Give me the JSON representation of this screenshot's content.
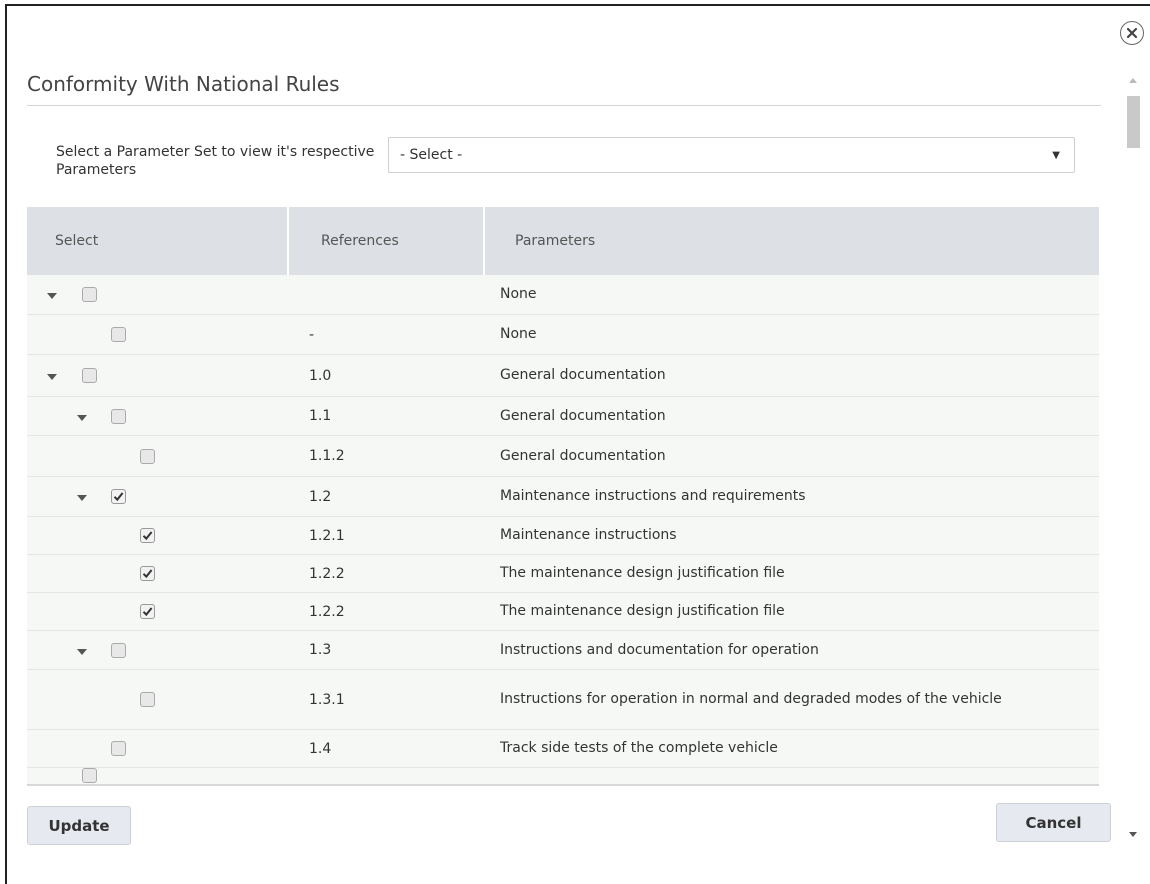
{
  "dialog": {
    "title": "Conformity With National Rules",
    "close_icon": "close-icon"
  },
  "param_set": {
    "label": "Select a Parameter Set to view it's respective Parameters",
    "selected": "- Select -"
  },
  "table": {
    "headers": [
      "Select",
      "References",
      "Parameters"
    ],
    "rows": [
      {
        "level": 0,
        "expandable": true,
        "checked": false,
        "ref": "",
        "param": "None"
      },
      {
        "level": 1,
        "expandable": false,
        "checked": false,
        "ref": "-",
        "param": "None"
      },
      {
        "level": 0,
        "expandable": true,
        "checked": false,
        "ref": "1.0",
        "param": "General documentation"
      },
      {
        "level": 1,
        "expandable": true,
        "checked": false,
        "ref": "1.1",
        "param": "General documentation"
      },
      {
        "level": 2,
        "expandable": false,
        "checked": false,
        "ref": "1.1.2",
        "param": "General documentation"
      },
      {
        "level": 1,
        "expandable": true,
        "checked": true,
        "ref": "1.2",
        "param": "Maintenance instructions and requirements"
      },
      {
        "level": 2,
        "expandable": false,
        "checked": true,
        "ref": "1.2.1",
        "param": "Maintenance instructions"
      },
      {
        "level": 2,
        "expandable": false,
        "checked": true,
        "ref": "1.2.2",
        "param": "The maintenance design justification file"
      },
      {
        "level": 2,
        "expandable": false,
        "checked": true,
        "ref": "1.2.2",
        "param": "The maintenance design justification file"
      },
      {
        "level": 1,
        "expandable": true,
        "checked": false,
        "ref": "1.3",
        "param": "Instructions and documentation for operation"
      },
      {
        "level": 2,
        "expandable": false,
        "checked": false,
        "ref": "1.3.1",
        "param": "Instructions for operation in normal and degraded modes of the vehicle"
      },
      {
        "level": 1,
        "expandable": false,
        "checked": false,
        "ref": "1.4",
        "param": "Track side tests of the complete vehicle"
      },
      {
        "level": 0,
        "expandable": false,
        "checked": false,
        "ref": "",
        "param": ""
      }
    ]
  },
  "footer": {
    "update_label": "Update",
    "cancel_label": "Cancel"
  }
}
